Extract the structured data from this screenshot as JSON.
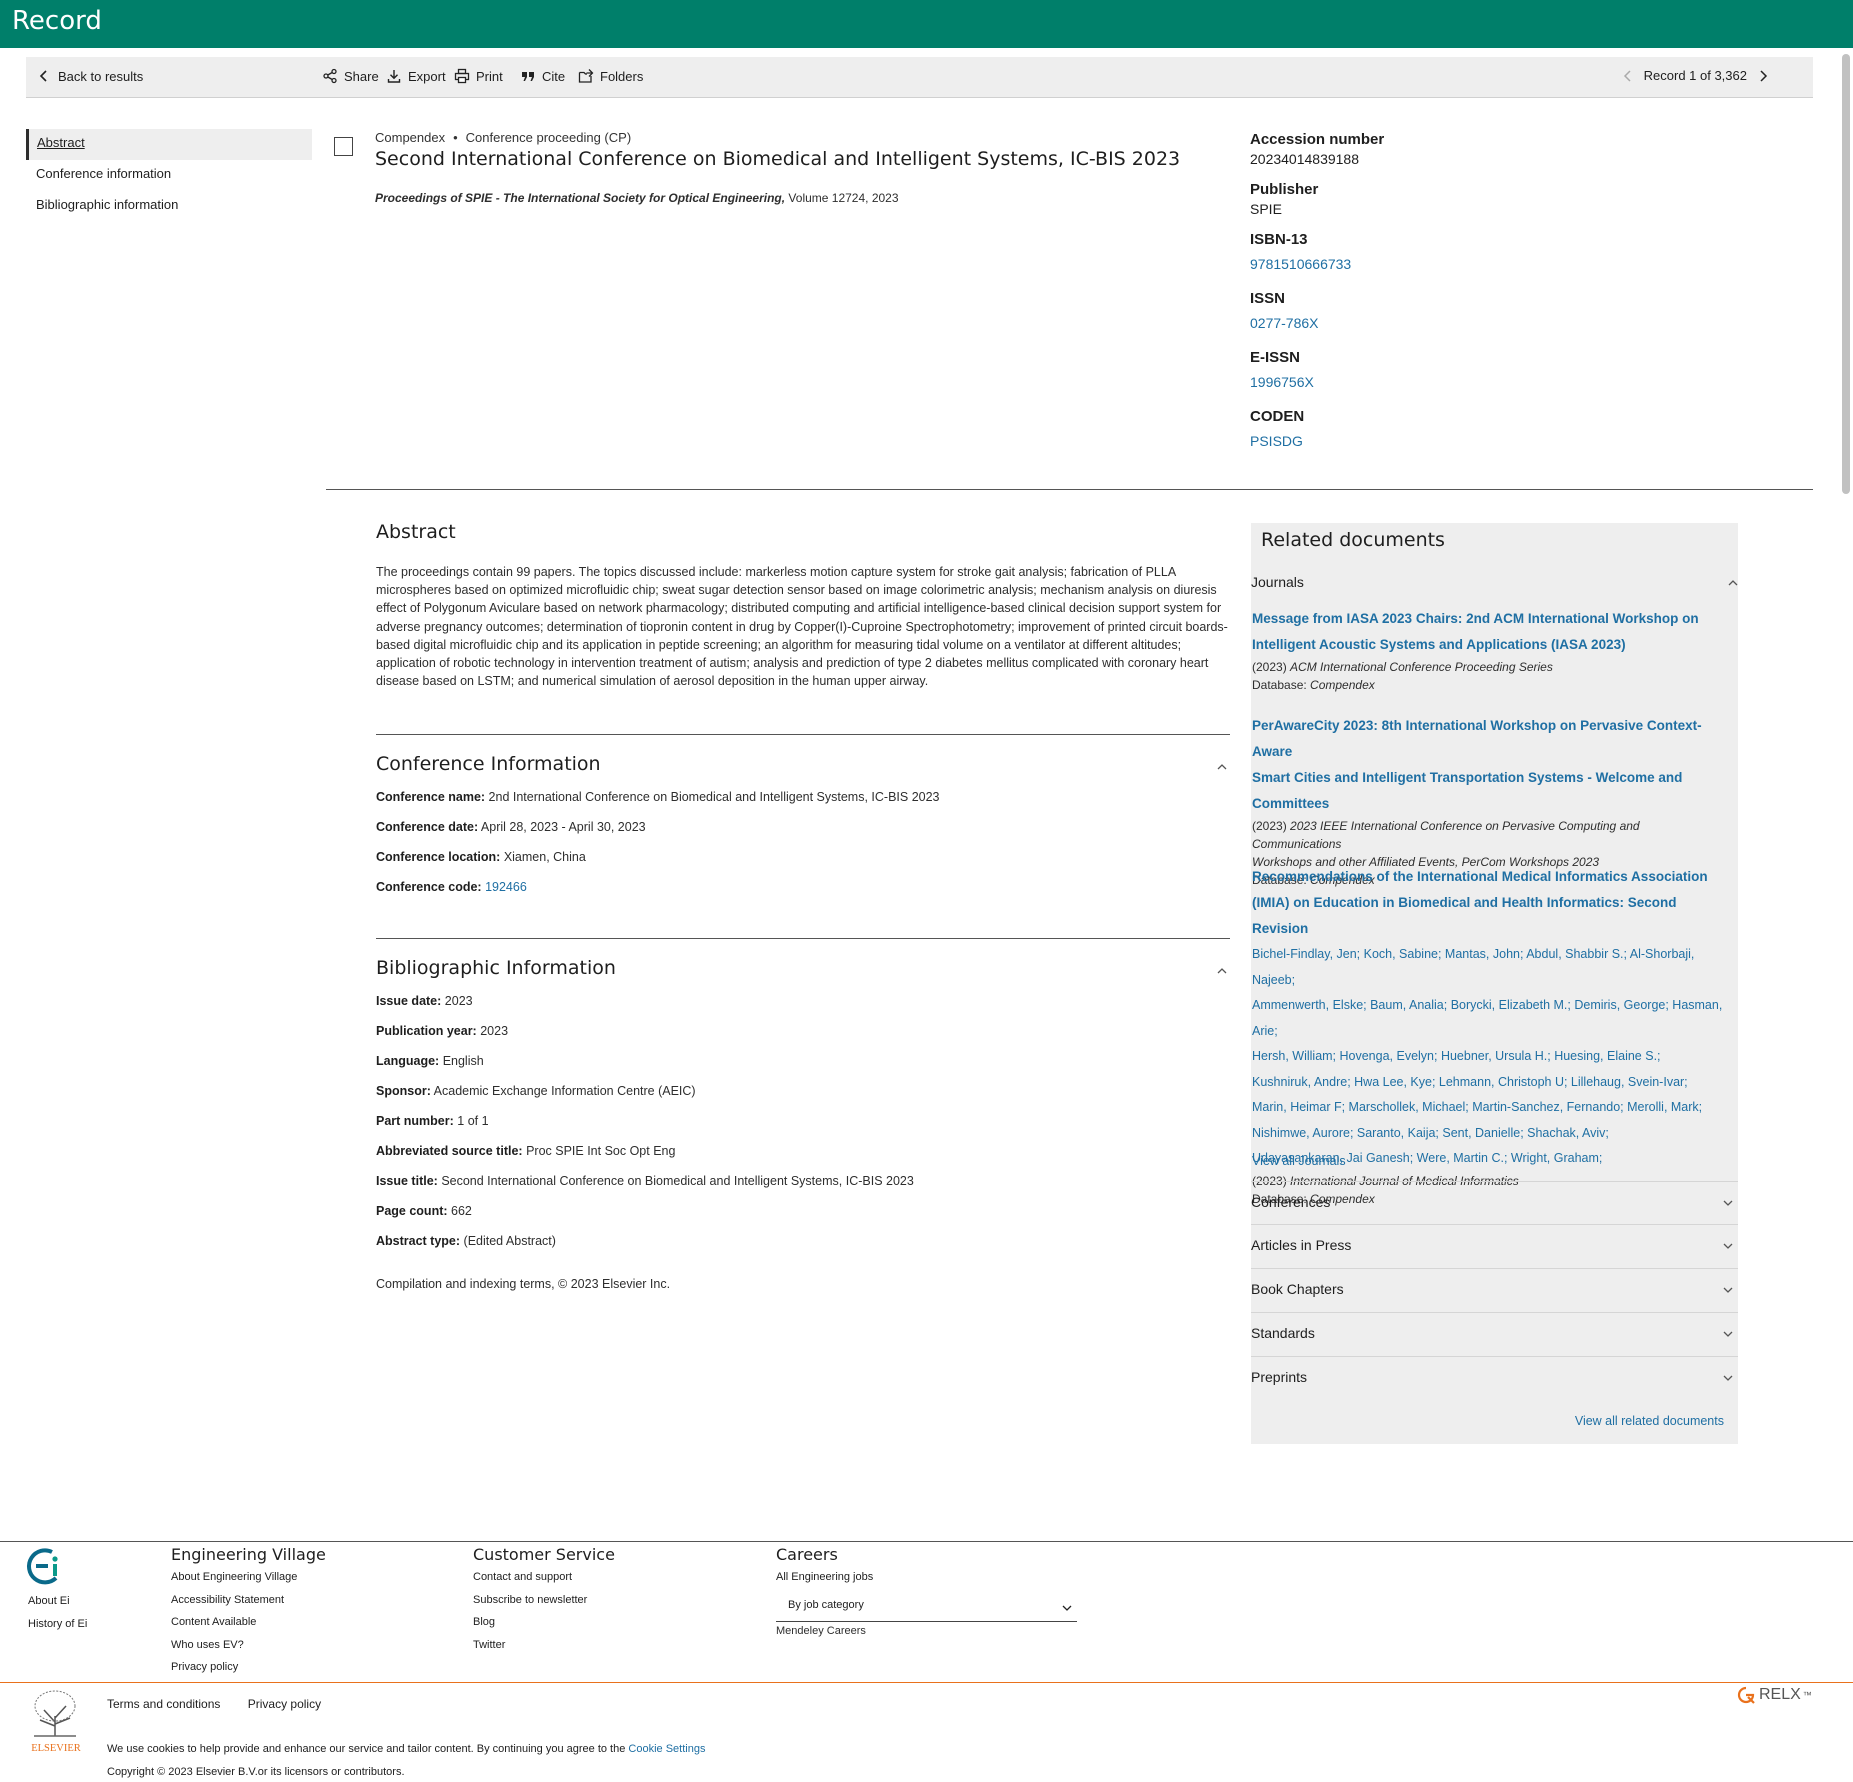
{
  "header": {
    "title": "Record"
  },
  "toolbar": {
    "back_label": "Back to results",
    "share_label": "Share",
    "export_label": "Export",
    "print_label": "Print",
    "cite_label": "Cite",
    "folders_label": "Folders",
    "record_nav": "Record 1 of 3,362"
  },
  "leftnav": {
    "items": [
      "Abstract",
      "Conference information",
      "Bibliographic information"
    ]
  },
  "record": {
    "database": "Compendex",
    "doc_type": "Conference proceeding (CP)",
    "title": "Second International Conference on Biomedical and Intelligent Systems, IC-BIS 2023",
    "source_title": "Proceedings of SPIE - The International Society for Optical Engineering,",
    "source_volume": "Volume 12724, 2023"
  },
  "meta": {
    "accession_label": "Accession number",
    "accession_value": "20234014839188",
    "publisher_label": "Publisher",
    "publisher_value": "SPIE",
    "isbn_label": "ISBN-13",
    "isbn_value": "9781510666733",
    "issn_label": "ISSN",
    "issn_value": "0277-786X",
    "eissn_label": "E-ISSN",
    "eissn_value": "1996756X",
    "coden_label": "CODEN",
    "coden_value": "PSISDG"
  },
  "abstract": {
    "heading": "Abstract",
    "text": "The proceedings contain 99 papers. The topics discussed include: markerless motion capture system for stroke gait analysis; fabrication of PLLA microspheres based on optimized microfluidic chip; sweat sugar detection sensor based on image colorimetric analysis; mechanism analysis on diuresis effect of Polygonum Aviculare based on network pharmacology; distributed computing and artificial intelligence-based clinical decision support system for adverse pregnancy outcomes; determination of tiopronin content in drug by Copper(I)-Cuproine Spectrophotometry; improvement of printed circuit boards-based digital microfluidic chip and its application in peptide screening; an algorithm for measuring tidal volume on a ventilator at different altitudes; application of robotic technology in intervention treatment of autism; analysis and prediction of type 2 diabetes mellitus complicated with coronary heart disease based on LSTM; and numerical simulation of aerosol deposition in the human upper airway."
  },
  "conference": {
    "heading": "Conference Information",
    "name_label": "Conference name:",
    "name_value": "2nd International Conference on Biomedical and Intelligent Systems, IC-BIS 2023",
    "date_label": "Conference date:",
    "date_value": "April 28, 2023 - April 30, 2023",
    "location_label": "Conference location:",
    "location_value": "Xiamen, China",
    "code_label": "Conference code:",
    "code_value": "192466"
  },
  "bibliographic": {
    "heading": "Bibliographic Information",
    "fields": [
      {
        "label": "Issue date:",
        "value": "2023"
      },
      {
        "label": "Publication year:",
        "value": "2023"
      },
      {
        "label": "Language:",
        "value": "English"
      },
      {
        "label": "Sponsor:",
        "value": "Academic Exchange Information Centre (AEIC)"
      },
      {
        "label": "Part number:",
        "value": "1 of 1"
      },
      {
        "label": "Abbreviated source title:",
        "value": "Proc SPIE Int Soc Opt Eng"
      },
      {
        "label": "Issue title:",
        "value": "Second International Conference on Biomedical and Intelligent Systems, IC-BIS 2023"
      },
      {
        "label": "Page count:",
        "value": "662"
      },
      {
        "label": "Abstract type:",
        "value": "(Edited Abstract)"
      }
    ],
    "copyright": "Compilation and indexing terms, © 2023 Elsevier Inc."
  },
  "related": {
    "heading": "Related documents",
    "journals_label": "Journals",
    "docs": [
      {
        "title_line1": "Message from IASA 2023 Chairs: 2nd ACM International Workshop on",
        "title_line2": "Intelligent Acoustic Systems and Applications (IASA 2023)",
        "year": "(2023)",
        "source": "ACM International Conference Proceeding Series",
        "db_label": "Database:",
        "db": "Compendex"
      },
      {
        "title_line1": "PerAwareCity 2023: 8th International Workshop on Pervasive Context-Aware",
        "title_line2": "Smart Cities and Intelligent Transportation Systems - Welcome and",
        "title_line3": "Committees",
        "year": "(2023)",
        "source_line1": "2023 IEEE International Conference on Pervasive Computing and Communications",
        "source_line2": "Workshops and other Affiliated Events, PerCom Workshops 2023",
        "db_label": "Database:",
        "db": "Compendex"
      },
      {
        "title_line1": "Recommendations of the International Medical Informatics Association",
        "title_line2": "(IMIA) on Education in Biomedical and Health Informatics: Second Revision",
        "authors": [
          "Bichel-Findlay, Jen; Koch, Sabine; Mantas, John; Abdul, Shabbir S.; Al-Shorbaji, Najeeb;",
          "Ammenwerth, Elske; Baum, Analia; Borycki, Elizabeth M.; Demiris, George; Hasman, Arie;",
          "Hersh, William; Hovenga, Evelyn; Huebner, Ursula H.; Huesing, Elaine S.;",
          "Kushniruk, Andre; Hwa Lee, Kye; Lehmann, Christoph U; Lillehaug, Svein-Ivar;",
          "Marin, Heimar F; Marschollek, Michael; Martin-Sanchez, Fernando; Merolli, Mark;",
          "Nishimwe, Aurore; Saranto, Kaija; Sent, Danielle; Shachak, Aviv;",
          "Udayasankaran, Jai Ganesh; Were, Martin C.; Wright, Graham;"
        ],
        "year": "(2023)",
        "source": "International Journal of Medical Informatics",
        "db_label": "Database:",
        "db": "Compendex"
      }
    ],
    "view_all_journals": "View all Journals",
    "categories": [
      "Conferences",
      "Articles in Press",
      "Book Chapters",
      "Standards",
      "Preprints"
    ],
    "view_all_related": "View all related documents"
  },
  "footer": {
    "ei_links": [
      "About Ei",
      "History of Ei"
    ],
    "col1": {
      "heading": "Engineering Village",
      "links": [
        "About Engineering Village",
        "Accessibility Statement",
        "Content Available",
        "Who uses EV?",
        "Privacy policy"
      ]
    },
    "col2": {
      "heading": "Customer Service",
      "links": [
        "Contact and support",
        "Subscribe to newsletter",
        "Blog",
        "Twitter"
      ]
    },
    "col3": {
      "heading": "Careers",
      "link1": "All Engineering jobs",
      "select_value": "By job category",
      "link2": "Mendeley Careers"
    },
    "elsevier_wordmark": "ELSEVIER",
    "terms": "Terms and conditions",
    "privacy": "Privacy policy",
    "cookie_text": "We use cookies to help provide and enhance our service and tailor content. By continuing you agree to the",
    "cookie_link": "Cookie Settings",
    "copyright": "Copyright © 2023 Elsevier B.V.or its licensors or contributors.",
    "relx": "RELX",
    "relx_tm": "™"
  },
  "colors": {
    "header_bg": "#007f6a",
    "link": "#1f6fa3",
    "accent_orange": "#e9711c"
  }
}
